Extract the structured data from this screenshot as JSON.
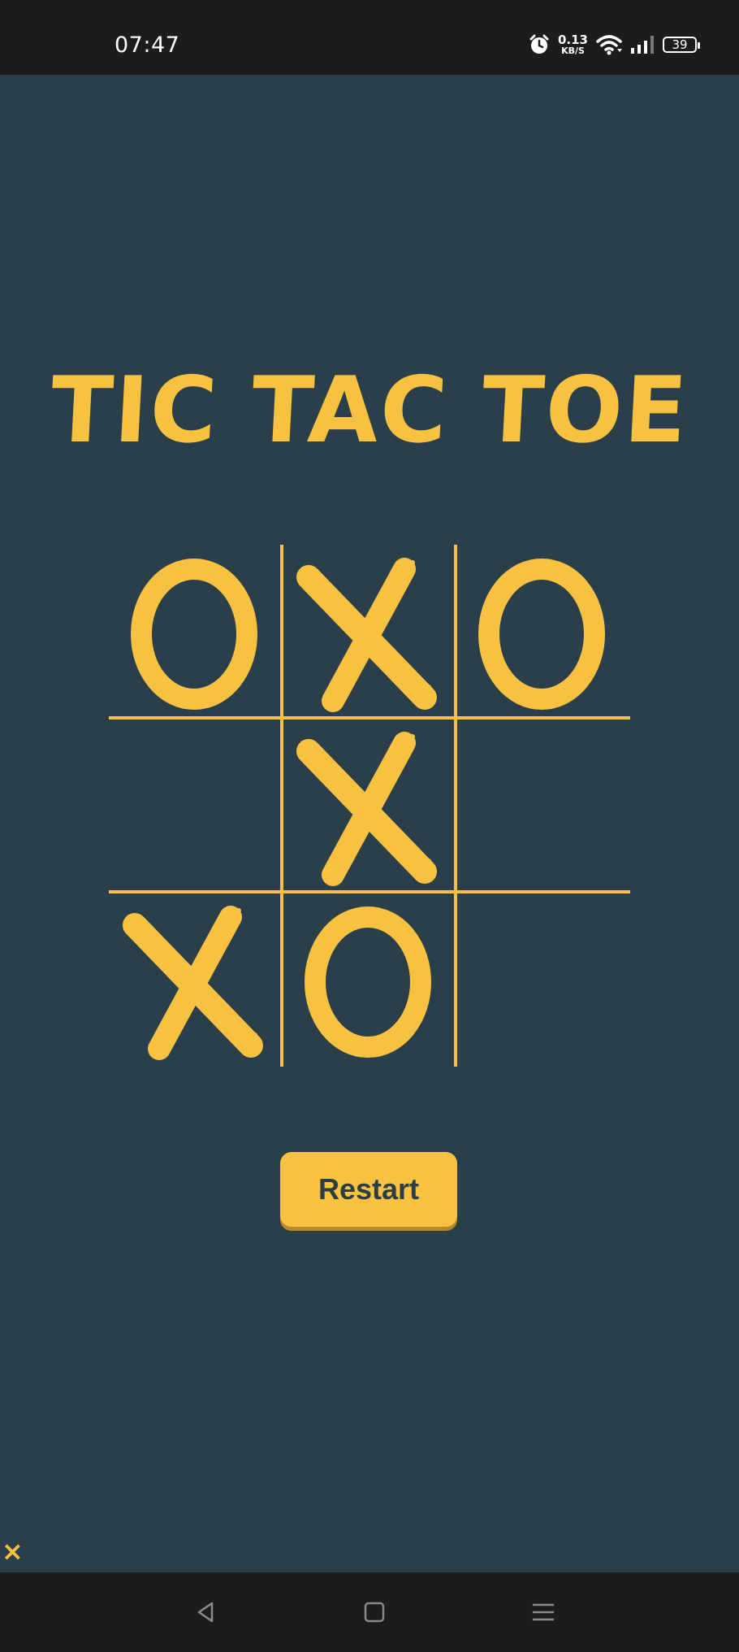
{
  "status_bar": {
    "time": "07:47",
    "net_speed_value": "0.13",
    "net_speed_unit": "KB/S",
    "battery": "39",
    "icons": [
      "alarm-icon",
      "wifi-icon",
      "signal-icon",
      "battery-icon"
    ]
  },
  "game": {
    "title": "TIC TAC TOE",
    "board": [
      [
        "O",
        "X",
        "O"
      ],
      [
        "",
        "X",
        ""
      ],
      [
        "X",
        "O",
        ""
      ]
    ],
    "restart_label": "Restart",
    "current_player_marker": "×"
  },
  "nav": {
    "icons": [
      "back-icon",
      "home-icon",
      "menu-icon"
    ]
  },
  "colors": {
    "background": "#2b3f4a",
    "accent": "#f7c242",
    "bar": "#1b1c1b",
    "button_text": "#2d3d44"
  }
}
